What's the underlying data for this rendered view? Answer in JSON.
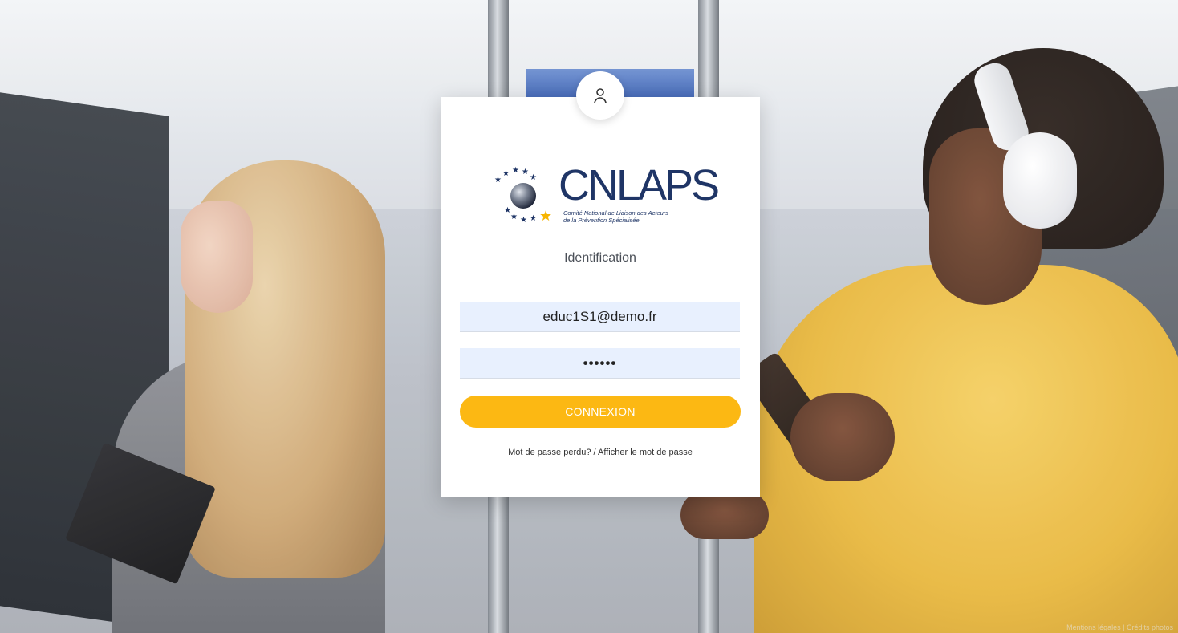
{
  "login": {
    "title": "Identification",
    "email_value": "educ1S1@demo.fr",
    "password_value": "••••••",
    "submit_label": "CONNEXION",
    "lost_password_label": "Mot de passe perdu?",
    "separator": " / ",
    "show_password_label": "Afficher le mot de passe"
  },
  "logo": {
    "wordmark": "CNLAPS",
    "subtitle_line1": "Comité National de Liaison des Acteurs",
    "subtitle_line2": "de la Prévention Spécialisée"
  },
  "footer": {
    "text": "Mentions légales | Crédits photos"
  },
  "colors": {
    "accent": "#fcb813",
    "brand": "#1f3566",
    "input_bg": "#e8f0fe"
  },
  "icons": {
    "avatar": "user-icon"
  }
}
